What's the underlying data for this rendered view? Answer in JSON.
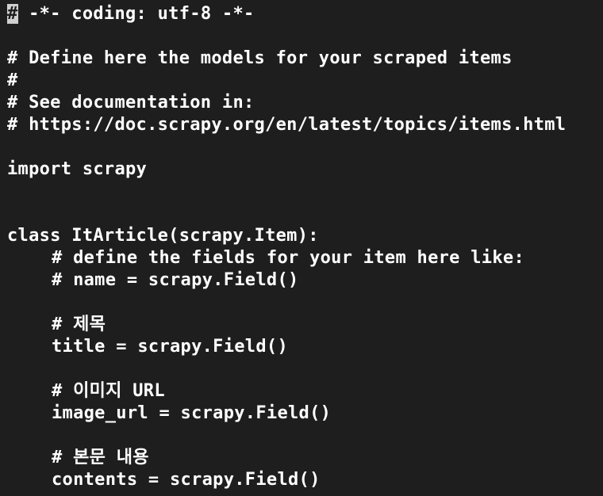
{
  "editor": {
    "lines": [
      {
        "cursor_char": "#",
        "rest": " -*- coding: utf-8 -*-"
      },
      {
        "text": ""
      },
      {
        "text": "# Define here the models for your scraped items"
      },
      {
        "text": "#"
      },
      {
        "text": "# See documentation in:"
      },
      {
        "text": "# https://doc.scrapy.org/en/latest/topics/items.html"
      },
      {
        "text": ""
      },
      {
        "text": "import scrapy"
      },
      {
        "text": ""
      },
      {
        "text": ""
      },
      {
        "text": "class ItArticle(scrapy.Item):"
      },
      {
        "text": "# define the fields for your item here like:"
      },
      {
        "text": "# name = scrapy.Field()"
      },
      {
        "text": ""
      },
      {
        "text": "# 제목"
      },
      {
        "text": "title = scrapy.Field()"
      },
      {
        "text": ""
      },
      {
        "text": "# 이미지 URL"
      },
      {
        "text": "image_url = scrapy.Field()"
      },
      {
        "text": ""
      },
      {
        "text": "# 본문 내용"
      },
      {
        "text": "contents = scrapy.Field()"
      }
    ]
  }
}
